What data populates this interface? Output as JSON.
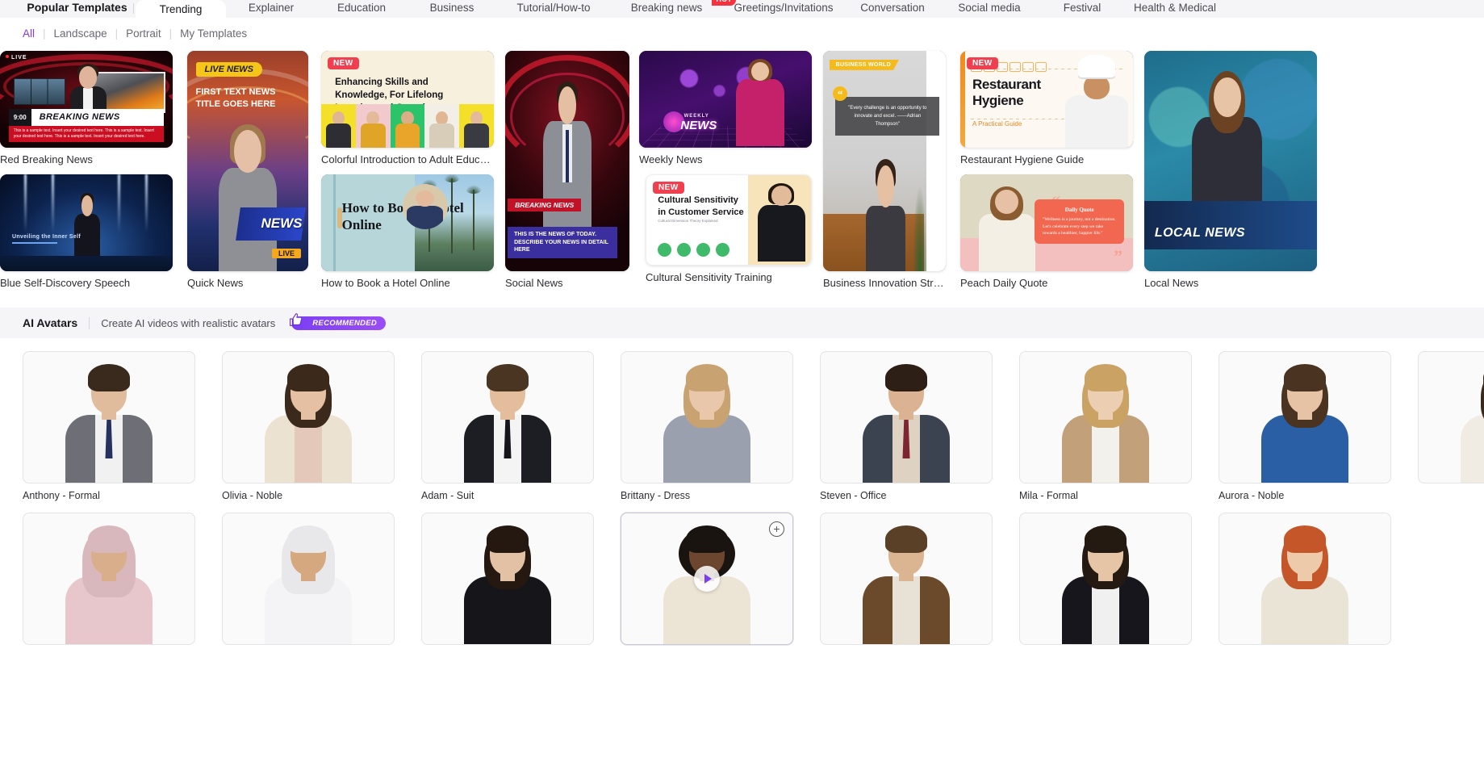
{
  "tabs": {
    "items": [
      {
        "label": "Popular Templates",
        "state": "bold"
      },
      {
        "label": "Trending",
        "state": "selected"
      },
      {
        "label": "Explainer",
        "state": "normal"
      },
      {
        "label": "Education",
        "state": "normal"
      },
      {
        "label": "Business",
        "state": "normal"
      },
      {
        "label": "Tutorial/How-to",
        "state": "normal"
      },
      {
        "label": "Breaking news",
        "state": "normal",
        "badge": "HOT"
      },
      {
        "label": "Greetings/Invitations",
        "state": "normal"
      },
      {
        "label": "Conversation",
        "state": "normal"
      },
      {
        "label": "Social media",
        "state": "normal"
      },
      {
        "label": "Festival",
        "state": "normal"
      },
      {
        "label": "Health & Medical",
        "state": "normal"
      }
    ]
  },
  "filters": {
    "items": [
      {
        "label": "All",
        "active": true
      },
      {
        "label": "Landscape",
        "active": false
      },
      {
        "label": "Portrait",
        "active": false
      },
      {
        "label": "My Templates",
        "active": false
      }
    ],
    "separator": "|"
  },
  "templates": {
    "red_breaking_news": {
      "title": "Red Breaking News",
      "live_label": "LIVE",
      "time": "9:00",
      "headline": "BREAKING NEWS",
      "ticker": "This is a sample text. Insert your desired text here. This is a sample text. Insert your desired text here. This is a sample text. Insert your desired text here."
    },
    "blue_self_discovery": {
      "title": "Blue Self-Discovery Speech",
      "overlay_text": "Unveiling the Inner Self"
    },
    "quick_news": {
      "title": "Quick News",
      "pill": "LIVE NEWS",
      "headline": "FIRST TEXT NEWS TITLE GOES HERE",
      "news_word": "NEWS",
      "live_tag": "LIVE"
    },
    "colorful_education": {
      "title": "Colorful Introduction to Adult Education",
      "badge": "NEW",
      "headline": "Enhancing Skills and Knowledge, For Lifelong Learning and Growth"
    },
    "hotel_online": {
      "title": "How to Book a Hotel Online",
      "headline": "How to Book a Hotel Online"
    },
    "social_news": {
      "title": "Social News",
      "breaking_label": "BREAKING NEWS",
      "body": "THIS IS THE  NEWS OF TODAY. DESCRIBE YOUR NEWS IN DETAIL HERE"
    },
    "weekly_news": {
      "title": "Weekly News",
      "small_label": "WEEKLY",
      "big_label": "NEWS"
    },
    "cultural_sensitivity": {
      "title": "Cultural Sensitivity Training",
      "badge": "NEW",
      "headline": "Cultural Sensitivity in Customer Service",
      "subtitle": "Cultural Dimension Theory Explained"
    },
    "business_innovation": {
      "title": "Business Innovation Strategies…",
      "tag": "BUSINESS WORLD",
      "quote": "\"Every challenge is an opportunity to innovate and excel. ——Adrian Thompson\""
    },
    "restaurant_hygiene": {
      "title": "Restaurant Hygiene Guide",
      "badge": "NEW",
      "heading_line1": "Restaurant",
      "heading_line2": "Hygiene",
      "subtitle": "A Practical Guide"
    },
    "peach_daily_quote": {
      "title": "Peach Daily Quote",
      "card_title": "Daily Quote",
      "card_text": "\"Wellness is a journey, not a destination. Let's celebrate every step we take towards a healthier, happier life.\""
    },
    "local_news": {
      "title": "Local News",
      "overlay_text": "LOCAL NEWS"
    }
  },
  "ai_avatars": {
    "section_title": "AI Avatars",
    "section_subtitle": "Create AI videos with realistic avatars",
    "recommended_badge": "RECOMMENDED",
    "add_icon_label": "+",
    "items": [
      {
        "name": "Anthony - Formal",
        "skin": "#e0bb9c",
        "hair": "#3a2a1e",
        "outfit": "#6e6e76",
        "shirt": "#f1f1f1",
        "tie": "#25315f",
        "hair_style": "short"
      },
      {
        "name": "Olivia - Noble",
        "skin": "#e5c0a2",
        "hair": "#3b2a1c",
        "outfit": "#ece2d2",
        "shirt": "#e4c9bb",
        "tie": "",
        "hair_style": "long"
      },
      {
        "name": "Adam - Suit",
        "skin": "#e3bd9c",
        "hair": "#4a3522",
        "outfit": "#1d1d24",
        "shirt": "#f4f4f4",
        "tie": "#15151b",
        "hair_style": "short"
      },
      {
        "name": "Brittany - Dress",
        "skin": "#e8c7ab",
        "hair": "#c8a271",
        "outfit": "#9aa0ae",
        "shirt": "#9aa0ae",
        "tie": "",
        "hair_style": "long"
      },
      {
        "name": "Steven - Office",
        "skin": "#dcb392",
        "hair": "#2d1f15",
        "outfit": "#3c4350",
        "shirt": "#ded3c2",
        "tie": "#7d2530",
        "hair_style": "short"
      },
      {
        "name": "Mila - Formal",
        "skin": "#eccfb3",
        "hair": "#c9a264",
        "outfit": "#c2a17a",
        "shirt": "#f3f1ec",
        "tie": "",
        "hair_style": "long"
      },
      {
        "name": "Aurora - Noble",
        "skin": "#e7c3a5",
        "hair": "#4a3320",
        "outfit": "#2a5fa5",
        "shirt": "#2a5fa5",
        "tie": "",
        "hair_style": "long"
      },
      {
        "name": "",
        "skin": "#e7c3a5",
        "hair": "#3a2a1e",
        "outfit": "#f0ece3",
        "shirt": "#f0ece3",
        "tie": "",
        "hair_style": "long"
      },
      {
        "name": "",
        "skin": "#d9ae8a",
        "hair": "#d8b8bd",
        "outfit": "#e7c7cb",
        "shirt": "#e7c7cb",
        "tie": "",
        "hair_style": "hijab"
      },
      {
        "name": "",
        "skin": "#d6a87f",
        "hair": "#e8e8ea",
        "outfit": "#f4f4f6",
        "shirt": "#f4f4f6",
        "tie": "",
        "hair_style": "keffiyeh"
      },
      {
        "name": "",
        "skin": "#e3c1a4",
        "hair": "#241811",
        "outfit": "#15151a",
        "shirt": "#15151a",
        "tie": "",
        "hair_style": "long"
      },
      {
        "name": "",
        "skin": "#6d4630",
        "hair": "#1a1410",
        "outfit": "#ece4d4",
        "shirt": "#ece4d4",
        "tie": "",
        "hair_style": "afro",
        "selected": true,
        "has_play": true,
        "has_add": true
      },
      {
        "name": "",
        "skin": "#dbb491",
        "hair": "#5a4026",
        "outfit": "#6b4a2c",
        "shirt": "#e8e2d6",
        "tie": "",
        "hair_style": "short"
      },
      {
        "name": "",
        "skin": "#e6c4a6",
        "hair": "#241a12",
        "outfit": "#16161c",
        "shirt": "#f0f0f0",
        "tie": "",
        "hair_style": "long"
      },
      {
        "name": "",
        "skin": "#eccaaa",
        "hair": "#c4562a",
        "outfit": "#e9e4d6",
        "shirt": "#e9e4d6",
        "tie": "",
        "hair_style": "long"
      }
    ]
  },
  "colors": {
    "accent_purple": "#7c3aed",
    "badge_red": "#f04050",
    "badge_hot": "#f5333f",
    "section_bg": "#f5f5f7"
  }
}
